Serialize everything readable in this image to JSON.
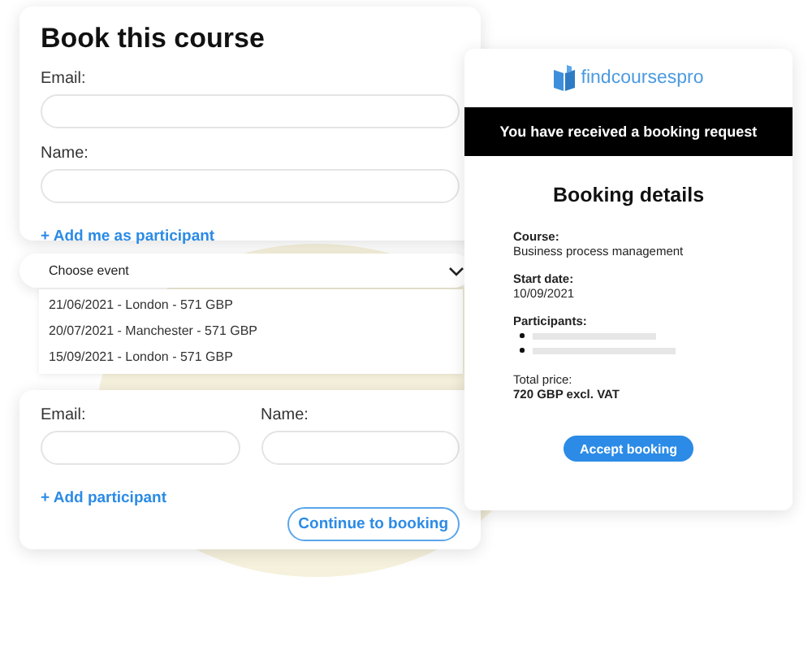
{
  "booking_form": {
    "title": "Book this course",
    "fields": [
      {
        "label": "Email:"
      },
      {
        "label": "Name:"
      }
    ],
    "add_link": "+ Add me as participant"
  },
  "event_select": {
    "placeholder": "Choose event",
    "expanded": true,
    "options": [
      {
        "label": "21/06/2021 - London - 571 GBP"
      },
      {
        "label": "20/07/2021 - Manchester - 571 GBP"
      },
      {
        "label": "15/09/2021 - London - 571 GBP"
      }
    ]
  },
  "participant_form": {
    "fields": [
      {
        "label": "Email:"
      },
      {
        "label": "Name:"
      }
    ],
    "add_link": "+ Add participant",
    "button": "Continue to booking"
  },
  "email_preview": {
    "logo": "findcoursespro",
    "banner": "You have received a booking request",
    "heading": "Booking details",
    "course_label": "Course:",
    "course": "Business process management",
    "start_label": "Start date:",
    "start": "10/09/2021",
    "participants_label": "Participants:",
    "participants": [
      {
        "kind": "redacted"
      },
      {
        "kind": "redacted"
      }
    ],
    "price_label": "Total price:",
    "price": "720 GBP excl. VAT",
    "button": "Accept booking"
  }
}
